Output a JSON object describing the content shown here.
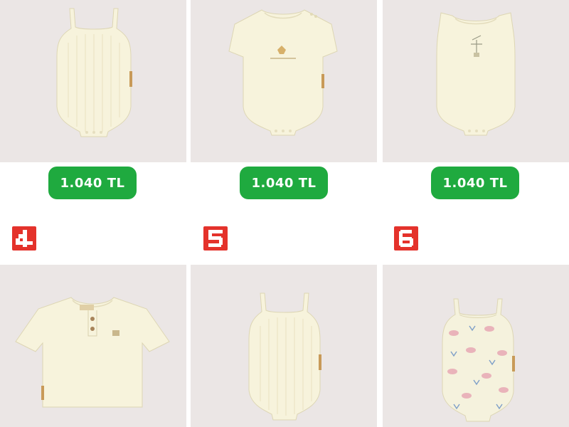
{
  "colors": {
    "price_background": "#1faa3f",
    "price_text": "#ffffff",
    "badge_background": "#e4322b",
    "badge_glyph": "#ffffff",
    "photo_background": "#ebe6e5",
    "garment_cream": "#f7f3dc"
  },
  "top_row": [
    {
      "image": "ribbed-cream-sleeveless-bodysuit",
      "price": "1.040 TL"
    },
    {
      "image": "cream-short-sleeve-bodysuit-with-print",
      "price": "1.040 TL"
    },
    {
      "image": "cream-sleeveless-bodysuit-with-print",
      "price": "1.040 TL"
    }
  ],
  "bottom_row": [
    {
      "number": "4",
      "image": "cream-henley-tshirt"
    },
    {
      "number": "5",
      "image": "ribbed-cream-strap-bodysuit"
    },
    {
      "number": "6",
      "image": "patterned-strap-bodysuit"
    }
  ]
}
